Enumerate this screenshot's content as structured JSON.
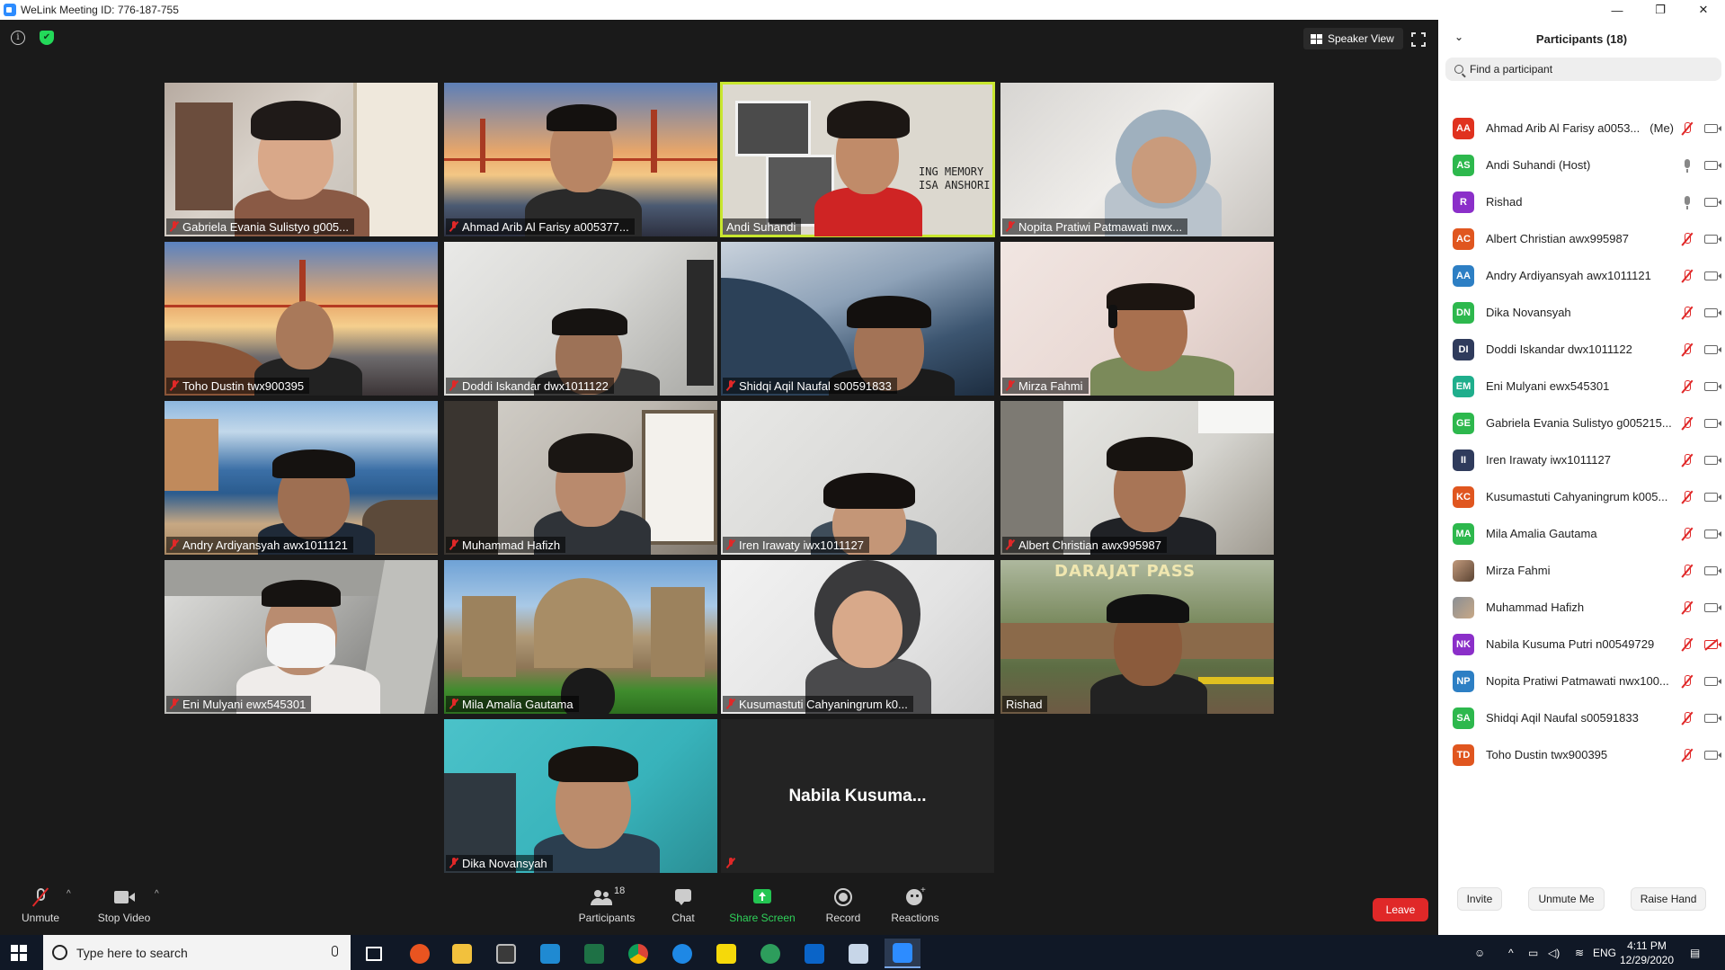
{
  "window": {
    "title": "WeLink Meeting ID: 776-187-755",
    "minimize": "—",
    "maximize": "❐",
    "close": "✕"
  },
  "view": {
    "speaker_view_label": "Speaker View"
  },
  "tiles": [
    {
      "name": "Gabriela Evania Sulistyo g005...",
      "muted": true
    },
    {
      "name": "Ahmad Arib Al Farisy a005377...",
      "muted": true
    },
    {
      "name": "Andi Suhandi",
      "muted": false,
      "active": true,
      "banner": "ING MEMORY\nISA ANSHORI"
    },
    {
      "name": "Nopita Pratiwi Patmawati nwx...",
      "muted": true
    },
    {
      "name": "Toho Dustin twx900395",
      "muted": true
    },
    {
      "name": "Doddi Iskandar dwx1011122",
      "muted": true
    },
    {
      "name": "Shidqi Aqil Naufal s00591833",
      "muted": true
    },
    {
      "name": "Mirza Fahmi",
      "muted": true
    },
    {
      "name": "Andry Ardiyansyah awx1011121",
      "muted": true
    },
    {
      "name": "Muhammad Hafizh",
      "muted": true
    },
    {
      "name": "Iren Irawaty iwx1011127",
      "muted": true
    },
    {
      "name": "Albert Christian awx995987",
      "muted": true
    },
    {
      "name": "Eni Mulyani ewx545301",
      "muted": true
    },
    {
      "name": "Mila Amalia Gautama",
      "muted": true
    },
    {
      "name": "Kusumastuti Cahyaningrum k0...",
      "muted": true
    },
    {
      "name": "Rishad",
      "muted": false,
      "sign": "DARAJAT PASS"
    },
    {
      "name": "Dika Novansyah",
      "muted": true
    },
    {
      "name": "",
      "muted": true,
      "center_name": "Nabila Kusuma..."
    }
  ],
  "toolbar": {
    "unmute": "Unmute",
    "stop_video": "Stop Video",
    "participants": "Participants",
    "participants_count": "18",
    "chat": "Chat",
    "share_screen": "Share Screen",
    "record": "Record",
    "reactions": "Reactions",
    "leave": "Leave"
  },
  "panel": {
    "title": "Participants (18)",
    "search_placeholder": "Find a participant",
    "participants": [
      {
        "initials": "AA",
        "color": "#e0321f",
        "name": "Ahmad Arib Al Farisy a0053...",
        "tag": "(Me)",
        "mic": "off",
        "cam": "on"
      },
      {
        "initials": "AS",
        "color": "#2db84d",
        "name": "Andi Suhandi (Host)",
        "tag": "",
        "mic": "on",
        "cam": "on"
      },
      {
        "initials": "R",
        "color": "#8b2fc9",
        "name": "Rishad",
        "tag": "",
        "mic": "on",
        "cam": "on"
      },
      {
        "initials": "AC",
        "color": "#e0561f",
        "name": "Albert Christian awx995987",
        "tag": "",
        "mic": "off",
        "cam": "on"
      },
      {
        "initials": "AA",
        "color": "#2d7fc4",
        "name": "Andry Ardiyansyah awx1011121",
        "tag": "",
        "mic": "off",
        "cam": "on"
      },
      {
        "initials": "DN",
        "color": "#2db84d",
        "name": "Dika Novansyah",
        "tag": "",
        "mic": "off",
        "cam": "on"
      },
      {
        "initials": "DI",
        "color": "#2f3b5c",
        "name": "Doddi Iskandar dwx1011122",
        "tag": "",
        "mic": "off",
        "cam": "on"
      },
      {
        "initials": "EM",
        "color": "#1fae8c",
        "name": "Eni Mulyani ewx545301",
        "tag": "",
        "mic": "off",
        "cam": "on"
      },
      {
        "initials": "GE",
        "color": "#2db84d",
        "name": "Gabriela Evania Sulistyo g005215...",
        "tag": "",
        "mic": "off",
        "cam": "on"
      },
      {
        "initials": "II",
        "color": "#2f3b5c",
        "name": "Iren Irawaty iwx1011127",
        "tag": "",
        "mic": "off",
        "cam": "on"
      },
      {
        "initials": "KC",
        "color": "#e0561f",
        "name": "Kusumastuti Cahyaningrum k005...",
        "tag": "",
        "mic": "off",
        "cam": "on"
      },
      {
        "initials": "MA",
        "color": "#2db84d",
        "name": "Mila Amalia Gautama",
        "tag": "",
        "mic": "off",
        "cam": "on"
      },
      {
        "initials": "",
        "color": "photo-1",
        "name": "Mirza Fahmi",
        "tag": "",
        "mic": "off",
        "cam": "on"
      },
      {
        "initials": "",
        "color": "photo-2",
        "name": "Muhammad Hafizh",
        "tag": "",
        "mic": "off",
        "cam": "on"
      },
      {
        "initials": "NK",
        "color": "#8b2fc9",
        "name": "Nabila Kusuma Putri n00549729",
        "tag": "",
        "mic": "off",
        "cam": "off"
      },
      {
        "initials": "NP",
        "color": "#2d7fc4",
        "name": "Nopita Pratiwi Patmawati nwx100...",
        "tag": "",
        "mic": "off",
        "cam": "on"
      },
      {
        "initials": "SA",
        "color": "#2db84d",
        "name": "Shidqi Aqil Naufal s00591833",
        "tag": "",
        "mic": "off",
        "cam": "on"
      },
      {
        "initials": "TD",
        "color": "#e0561f",
        "name": "Toho Dustin twx900395",
        "tag": "",
        "mic": "off",
        "cam": "on"
      }
    ],
    "actions": {
      "invite": "Invite",
      "unmute_me": "Unmute Me",
      "raise_hand": "Raise Hand"
    }
  },
  "taskbar": {
    "search_placeholder": "Type here to search",
    "language": "ENG",
    "time": "4:11 PM",
    "date": "12/29/2020"
  }
}
